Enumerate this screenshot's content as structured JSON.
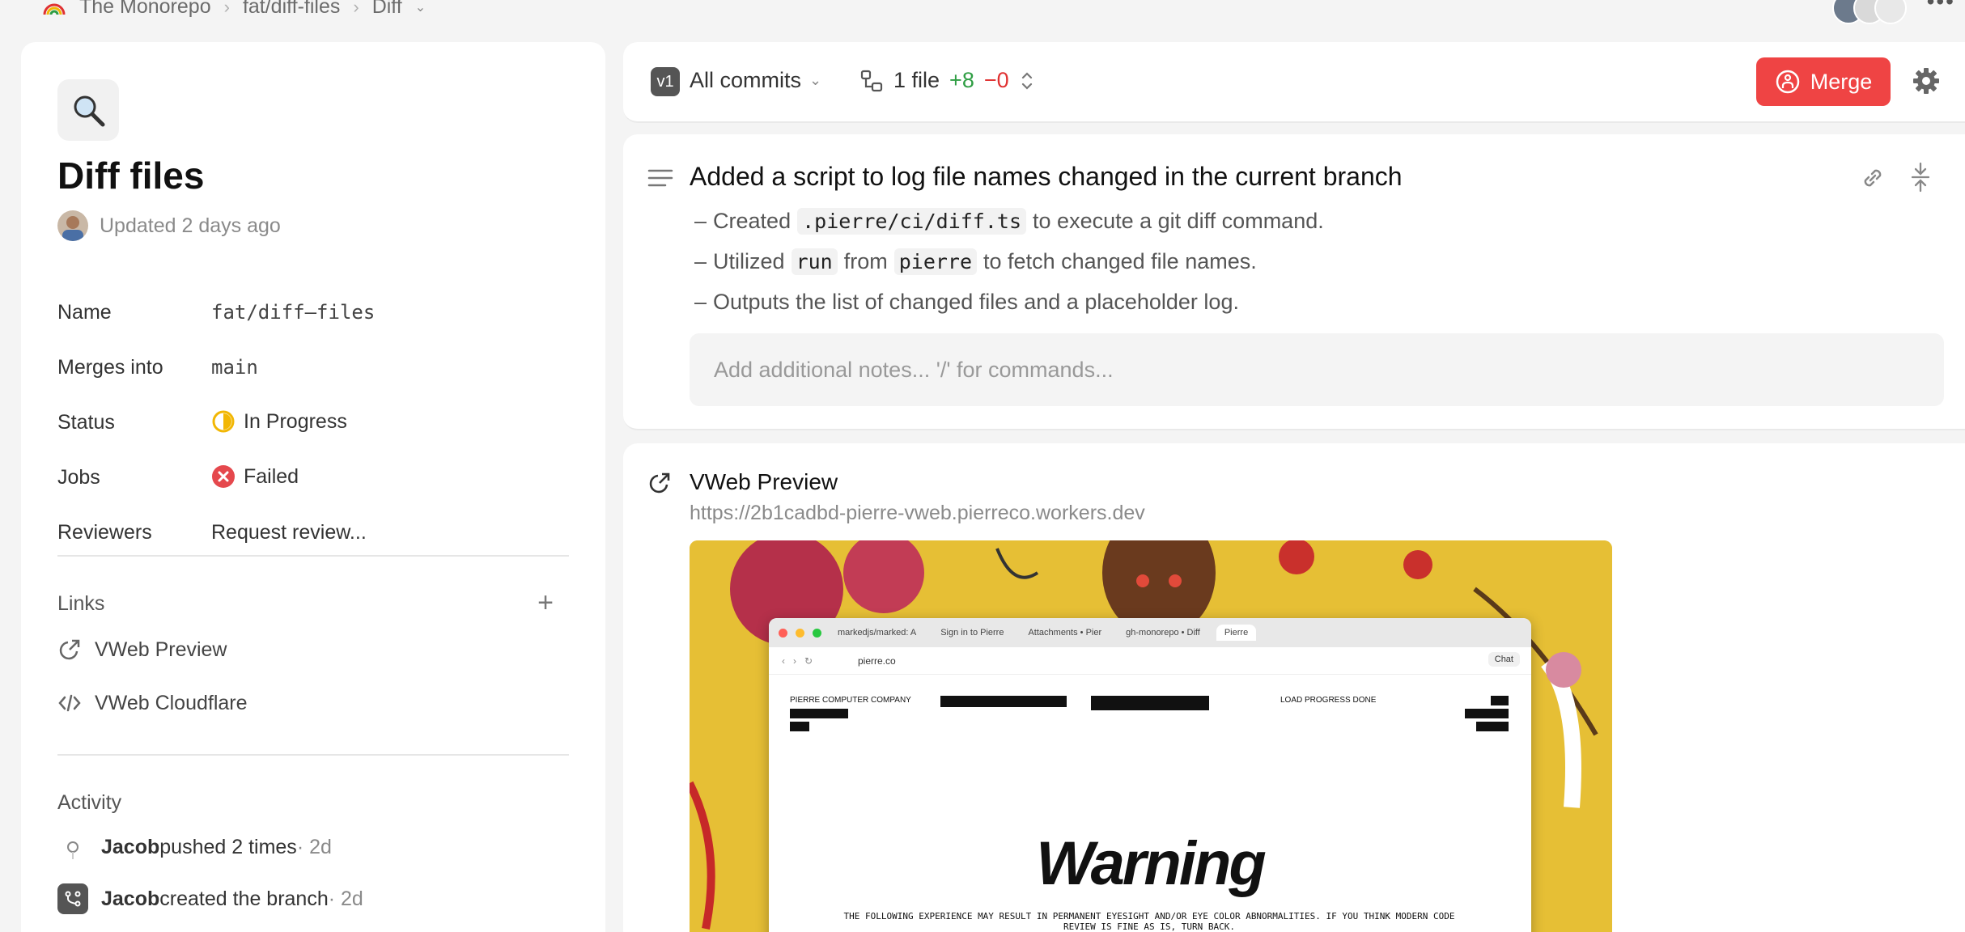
{
  "breadcrumb": {
    "items": [
      "The Monorepo",
      "fat/diff-files",
      "Diff"
    ]
  },
  "more_label": "•••",
  "sidebar": {
    "title": "Diff files",
    "updated": "Updated 2 days ago",
    "props": {
      "name_label": "Name",
      "name_value": "fat/diff–files",
      "merges_label": "Merges into",
      "merges_value": "main",
      "status_label": "Status",
      "status_value": "In Progress",
      "jobs_label": "Jobs",
      "jobs_value": "Failed",
      "reviewers_label": "Reviewers",
      "reviewers_value": "Request review..."
    },
    "links_title": "Links",
    "links": [
      "VWeb Preview",
      "VWeb Cloudflare"
    ],
    "activity_title": "Activity",
    "activity": [
      {
        "who": "Jacob",
        "what": " pushed 2 times",
        "when": " · 2d"
      },
      {
        "who": "Jacob",
        "what": " created the branch",
        "when": " · 2d"
      }
    ]
  },
  "toolbar": {
    "version": "v1",
    "commits_label": "All commits",
    "files_label": "1 file",
    "additions": "+8",
    "deletions": "−0",
    "merge_label": "Merge"
  },
  "commit": {
    "title": "Added a script to log file names changed in the current branch",
    "bullets": [
      {
        "pre": "Created ",
        "code": ".pierre/ci/diff.ts",
        "post": " to execute a git diff command."
      },
      {
        "pre": "Utilized ",
        "code": "run",
        "mid": " from ",
        "code2": "pierre",
        "post": " to fetch changed file names."
      },
      {
        "pre": "Outputs the list of changed files and a placeholder log."
      }
    ],
    "notes_placeholder": "Add additional notes... '/' for commands..."
  },
  "preview": {
    "title": "VWeb Preview",
    "url": "https://2b1cadbd-pierre-vweb.pierreco.workers.dev",
    "browser_tabs": [
      "markedjs/marked: A",
      "Sign in to Pierre",
      "Attachments • Pier",
      "gh-monorepo • Diff",
      "Pierre"
    ],
    "address": "pierre.co",
    "chat_label": "Chat",
    "site_company": "PIERRE COMPUTER COMPANY",
    "site_progress": "LOAD PROGRESS DONE",
    "warning_title": "Warning",
    "warning_text": "THE FOLLOWING EXPERIENCE MAY RESULT IN PERMANENT EYESIGHT AND/OR EYE COLOR ABNORMALITIES. IF YOU THINK MODERN CODE REVIEW IS FINE AS IS, TURN BACK."
  },
  "colors": {
    "merge": "#ef4444",
    "additions": "#2f9e44",
    "deletions": "#e03131",
    "status_inprogress": "#f2b705",
    "jobs_failed": "#e5484d"
  }
}
